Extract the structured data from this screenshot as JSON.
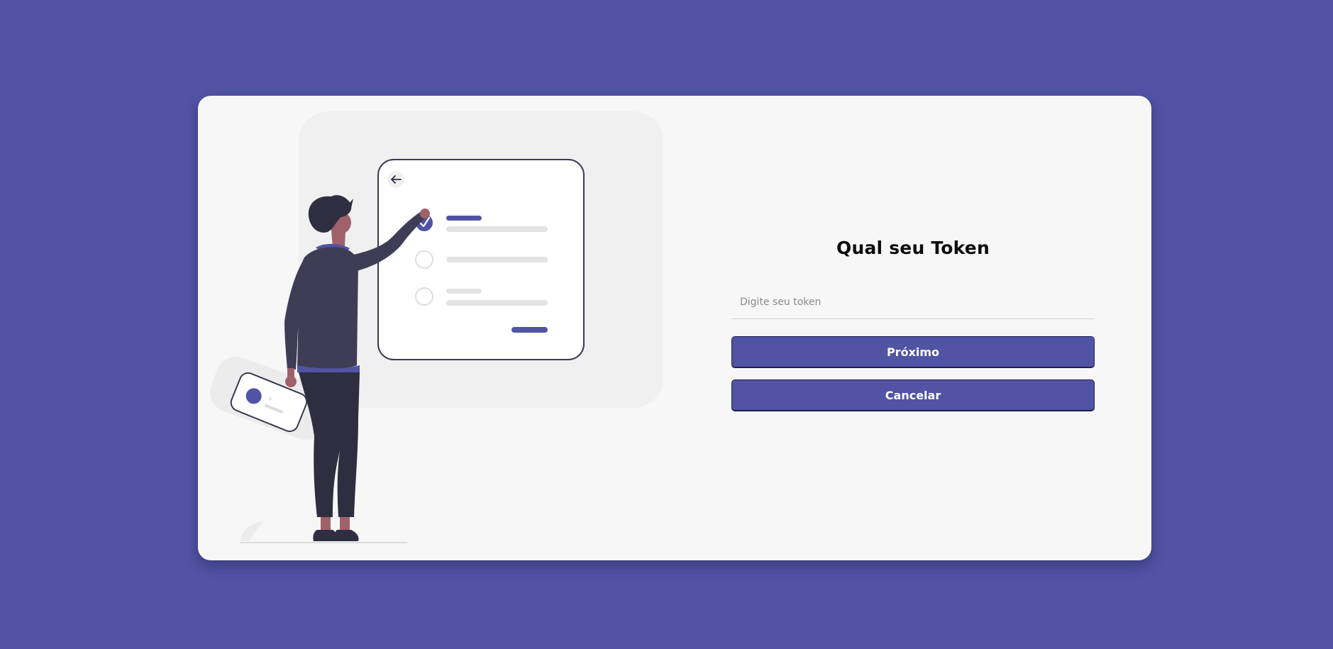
{
  "form": {
    "title": "Qual seu Token",
    "token_placeholder": "Digite seu token",
    "next_label": "Próximo",
    "cancel_label": "Cancelar"
  },
  "colors": {
    "background": "#5153a4",
    "card": "#f7f7f7",
    "accent": "#5153a4",
    "button_text": "#ffffff"
  },
  "illustration": {
    "checklist_items": [
      {
        "checked": true
      },
      {
        "checked": false
      },
      {
        "checked": false
      }
    ]
  }
}
